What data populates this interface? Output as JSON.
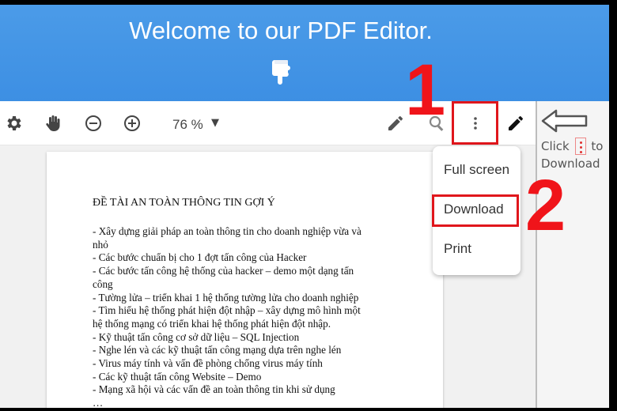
{
  "banner": {
    "title": "Welcome to our PDF Editor.",
    "background": "#3d8fe3"
  },
  "toolbar": {
    "icons": [
      "gear-icon",
      "hand-icon",
      "zoom-out-icon",
      "zoom-in-icon",
      "pen-icon",
      "search-icon",
      "more-vertical-icon",
      "pencil-icon"
    ],
    "zoom_level": "76 %",
    "zoom_caret": "▼"
  },
  "menu": {
    "items": [
      {
        "label": "Full screen"
      },
      {
        "label": "Download"
      },
      {
        "label": "Print"
      }
    ]
  },
  "hint": {
    "click": "Click",
    "to": "to",
    "download": "Download"
  },
  "annotations": {
    "step1": "1",
    "step2": "2",
    "highlight_color": "#e0161c"
  },
  "document": {
    "title": "ĐỀ TÀI AN TOÀN THÔNG TIN GỢI Ý",
    "lines": [
      "- Xây dựng giải pháp an toàn thông tin cho doanh nghiệp vừa và",
      "nhỏ",
      "- Các bước chuẩn bị cho 1 đợt tấn công của Hacker",
      "- Các bước tấn công hệ thống của hacker – demo một dạng tấn",
      "công",
      "- Tường lửa – triển khai 1 hệ thống tường lửa cho doanh nghiệp",
      "- Tìm hiểu hệ thống phát hiện đột nhập – xây dựng mô hình một",
      "hệ thống mạng có triển khai hệ thống phát hiện đột nhập.",
      "- Kỹ thuật tấn công cơ sở dữ liệu – SQL Injection",
      "- Nghe lén và các kỹ thuật tấn công mạng dựa trên nghe lén",
      "- Virus máy tính và vấn đề phòng chống virus máy tính",
      "- Các kỹ thuật tấn công Website – Demo",
      "- Mạng xã hội và các vấn đề an toàn thông tin khi sử dụng",
      "…"
    ]
  }
}
